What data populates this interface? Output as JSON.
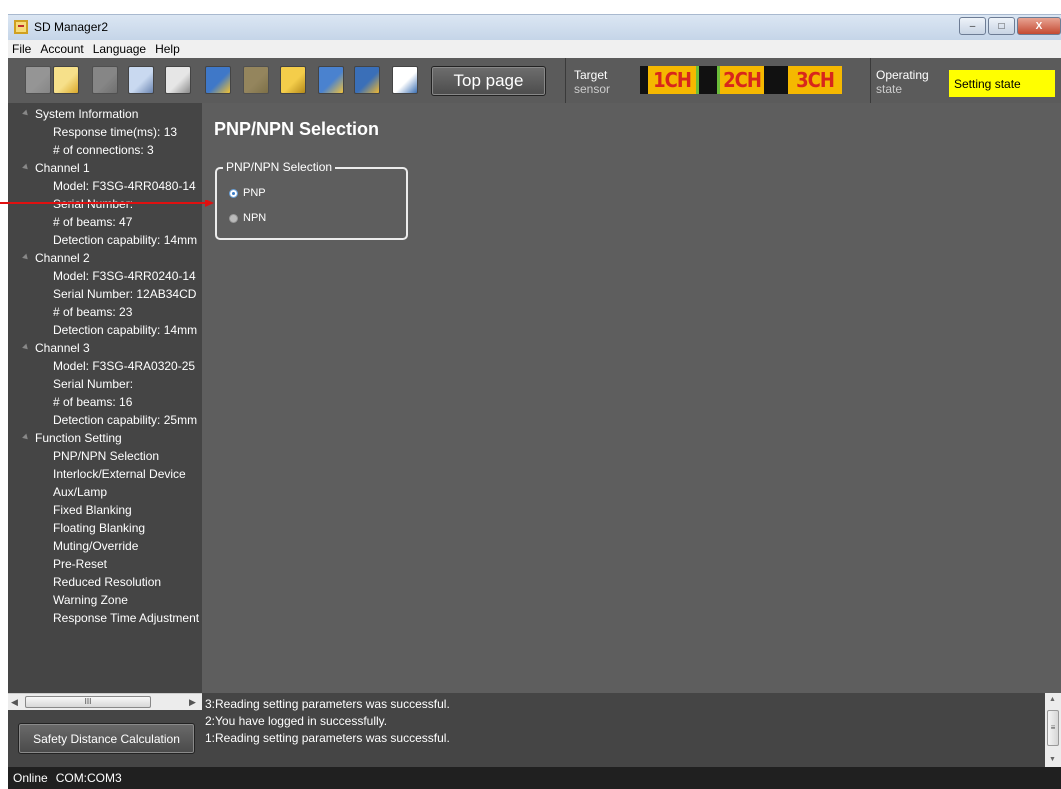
{
  "window": {
    "title": "SD Manager2",
    "buttons": {
      "minimize": "–",
      "maximize": "□",
      "close": "X"
    }
  },
  "menu": [
    "File",
    "Account",
    "Language",
    "Help"
  ],
  "toolbar": {
    "top_page_label": "Top page",
    "target_sensor_label": [
      "Target",
      "sensor"
    ],
    "channels": [
      "1CH",
      "2CH",
      "3CH"
    ],
    "operating_state_label": [
      "Operating",
      "state"
    ],
    "operating_state_value": "Setting state",
    "channel_color": "#f5b800",
    "channel_text_color": "#d8261c",
    "tools": [
      {
        "name": "new-file-icon",
        "disabled": true
      },
      {
        "name": "open-folder-icon",
        "disabled": false
      },
      {
        "name": "connect-icon",
        "disabled": true
      },
      {
        "name": "read-device-icon",
        "disabled": false
      },
      {
        "name": "write-device-icon",
        "disabled": false
      },
      {
        "name": "monitor-icon",
        "disabled": false
      },
      {
        "name": "key-icon",
        "disabled": true
      },
      {
        "name": "lock-icon",
        "disabled": false
      },
      {
        "name": "book-icon",
        "disabled": false
      },
      {
        "name": "copy-book-icon",
        "disabled": false
      },
      {
        "name": "list-icon",
        "disabled": false
      }
    ]
  },
  "sidebar": {
    "tree": [
      {
        "level": 0,
        "label": "System Information",
        "arrow": true
      },
      {
        "level": 1,
        "label": "Response time(ms): 13"
      },
      {
        "level": 1,
        "label": "# of connections: 3"
      },
      {
        "level": 0,
        "label": "Channel 1",
        "arrow": true
      },
      {
        "level": 1,
        "label": "Model: F3SG-4RR0480-14"
      },
      {
        "level": 1,
        "label": "Serial Number:"
      },
      {
        "level": 1,
        "label": "# of beams: 47"
      },
      {
        "level": 1,
        "label": "Detection capability: 14mm"
      },
      {
        "level": 0,
        "label": "Channel 2",
        "arrow": true
      },
      {
        "level": 1,
        "label": "Model: F3SG-4RR0240-14"
      },
      {
        "level": 1,
        "label": "Serial Number: 12AB34CD"
      },
      {
        "level": 1,
        "label": "# of beams: 23"
      },
      {
        "level": 1,
        "label": "Detection capability: 14mm"
      },
      {
        "level": 0,
        "label": "Channel 3",
        "arrow": true
      },
      {
        "level": 1,
        "label": "Model: F3SG-4RA0320-25"
      },
      {
        "level": 1,
        "label": "Serial Number:"
      },
      {
        "level": 1,
        "label": "# of beams: 16"
      },
      {
        "level": 1,
        "label": "Detection capability: 25mm"
      },
      {
        "level": 0,
        "label": "Function Setting",
        "arrow": true
      },
      {
        "level": 2,
        "label": "PNP/NPN Selection"
      },
      {
        "level": 2,
        "label": "Interlock/External Device"
      },
      {
        "level": 2,
        "label": "Aux/Lamp"
      },
      {
        "level": 2,
        "label": "Fixed Blanking"
      },
      {
        "level": 2,
        "label": "Floating Blanking"
      },
      {
        "level": 2,
        "label": "Muting/Override"
      },
      {
        "level": 2,
        "label": "Pre-Reset"
      },
      {
        "level": 2,
        "label": "Reduced Resolution"
      },
      {
        "level": 2,
        "label": "Warning Zone"
      },
      {
        "level": 2,
        "label": "Response Time Adjustment"
      }
    ],
    "scroll_thumb_label": "III",
    "safety_button_label": "Safety Distance Calculation"
  },
  "main": {
    "title": "PNP/NPN Selection",
    "group_title": "PNP/NPN Selection",
    "options": [
      {
        "label": "PNP",
        "selected": true
      },
      {
        "label": "NPN",
        "selected": false
      }
    ]
  },
  "log": [
    "3:Reading setting parameters was successful.",
    "2:You have logged in successfully.",
    "1:Reading setting parameters was successful."
  ],
  "statusbar": {
    "connection": "Online",
    "port": "COM:COM3"
  }
}
